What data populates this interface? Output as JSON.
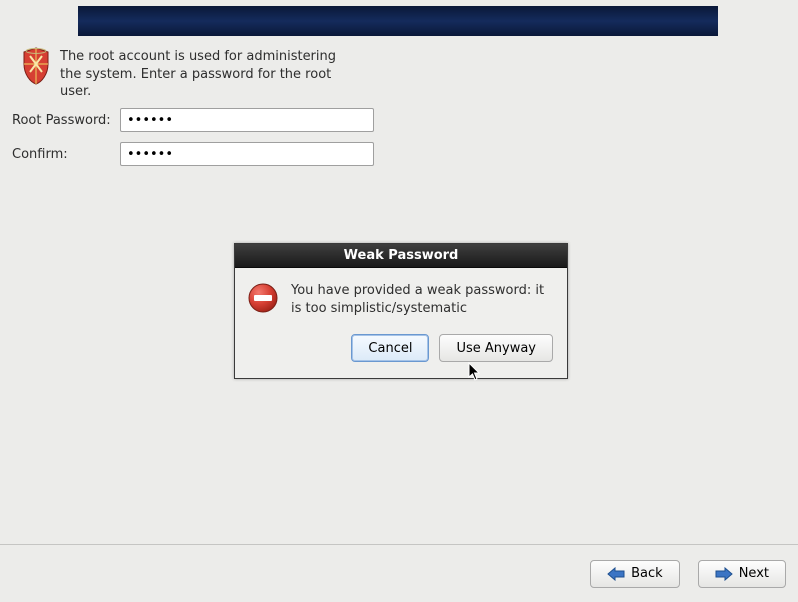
{
  "intro": {
    "text": "The root account is used for administering the system.  Enter a password for the root user."
  },
  "form": {
    "root_password_label": "Root Password:",
    "root_password_value": "••••••",
    "confirm_label": "Confirm:",
    "confirm_value": "••••••"
  },
  "dialog": {
    "title": "Weak Password",
    "message": "You have provided a weak password: it is too simplistic/systematic",
    "cancel_label": "Cancel",
    "use_anyway_label": "Use Anyway"
  },
  "nav": {
    "back_label": "Back",
    "next_label": "Next"
  },
  "colors": {
    "banner_dark": "#0a1838",
    "banner_mid": "#142b5c",
    "error_red": "#d63f33"
  }
}
